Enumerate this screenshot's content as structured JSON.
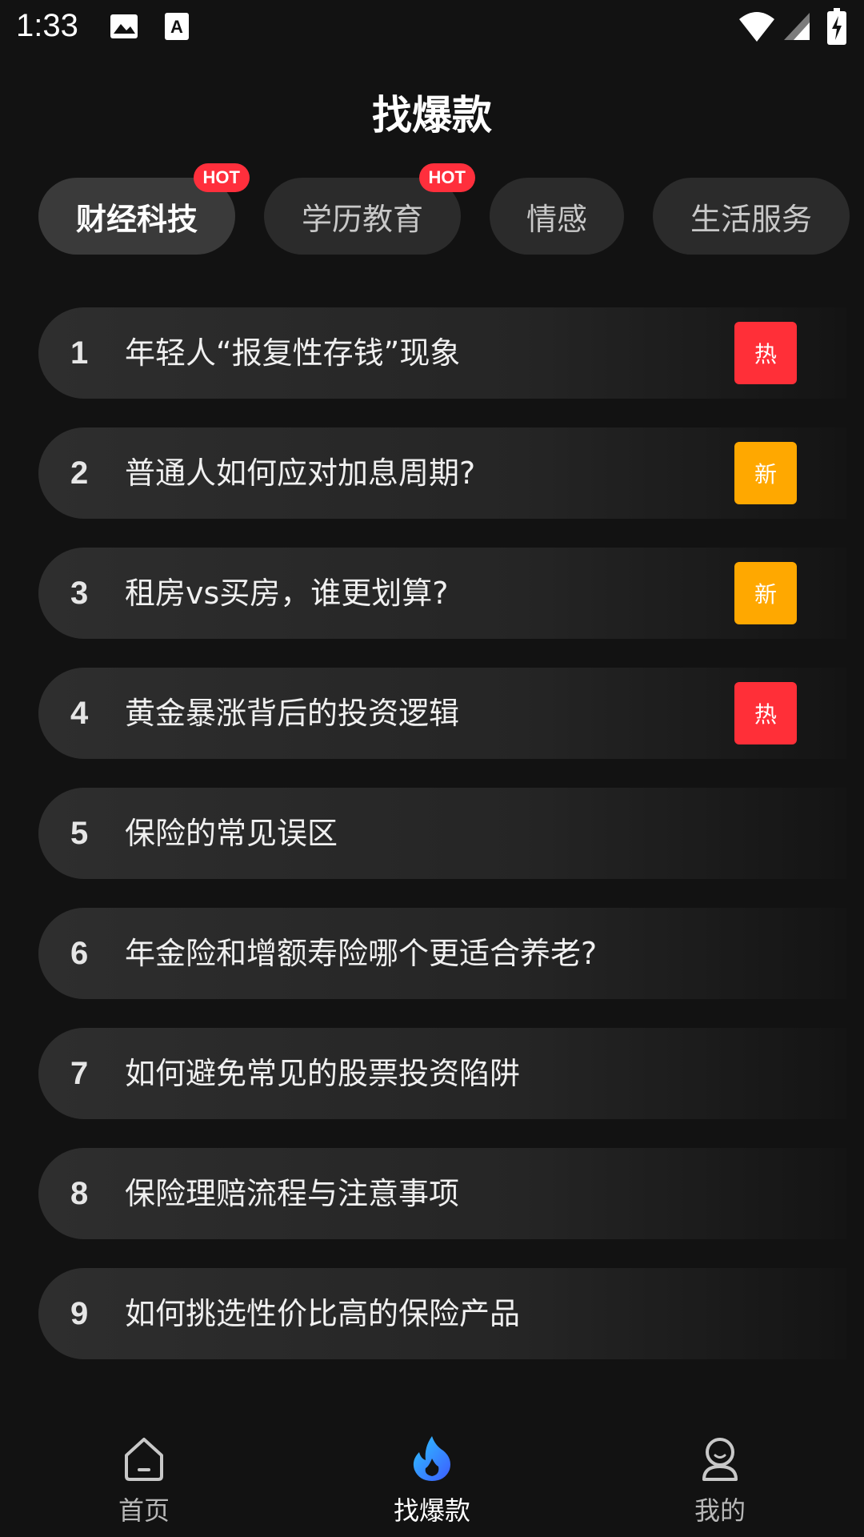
{
  "status_bar": {
    "time": "1:33",
    "icons": [
      "image-icon",
      "a-letter-icon",
      "wifi-icon",
      "signal-icon",
      "battery-icon"
    ]
  },
  "header": {
    "title": "找爆款"
  },
  "tabs": [
    {
      "label": "财经科技",
      "hot": true,
      "badge": "HOT",
      "active": true
    },
    {
      "label": "学历教育",
      "hot": true,
      "badge": "HOT",
      "active": false
    },
    {
      "label": "情感",
      "hot": false,
      "badge": "",
      "active": false
    },
    {
      "label": "生活服务",
      "hot": false,
      "badge": "",
      "active": false
    }
  ],
  "list": [
    {
      "rank": "1",
      "text": "年轻人“报复性存钱”现象",
      "tag": "热",
      "tag_color": "#ff2f38"
    },
    {
      "rank": "2",
      "text": "普通人如何应对加息周期?",
      "tag": "新",
      "tag_color": "#ffa800"
    },
    {
      "rank": "3",
      "text": "租房vs买房，谁更划算?",
      "tag": "新",
      "tag_color": "#ffa800"
    },
    {
      "rank": "4",
      "text": "黄金暴涨背后的投资逻辑",
      "tag": "热",
      "tag_color": "#ff2f38"
    },
    {
      "rank": "5",
      "text": "保险的常见误区",
      "tag": "",
      "tag_color": ""
    },
    {
      "rank": "6",
      "text": "年金险和增额寿险哪个更适合养老?",
      "tag": "",
      "tag_color": ""
    },
    {
      "rank": "7",
      "text": "如何避免常见的股票投资陷阱",
      "tag": "",
      "tag_color": ""
    },
    {
      "rank": "8",
      "text": "保险理赔流程与注意事项",
      "tag": "",
      "tag_color": ""
    },
    {
      "rank": "9",
      "text": "如何挑选性价比高的保险产品",
      "tag": "",
      "tag_color": ""
    }
  ],
  "bottom_nav": [
    {
      "label": "首页",
      "icon": "home-icon",
      "active": false
    },
    {
      "label": "找爆款",
      "icon": "flame-icon",
      "active": true
    },
    {
      "label": "我的",
      "icon": "profile-icon",
      "active": false
    }
  ],
  "colors": {
    "background": "#121212",
    "hot_badge": "#ff2f3c",
    "tag_hot": "#ff2f38",
    "tag_new": "#ffa800",
    "flame_gradient_start": "#2ec5ff",
    "flame_gradient_end": "#3d5bff"
  }
}
